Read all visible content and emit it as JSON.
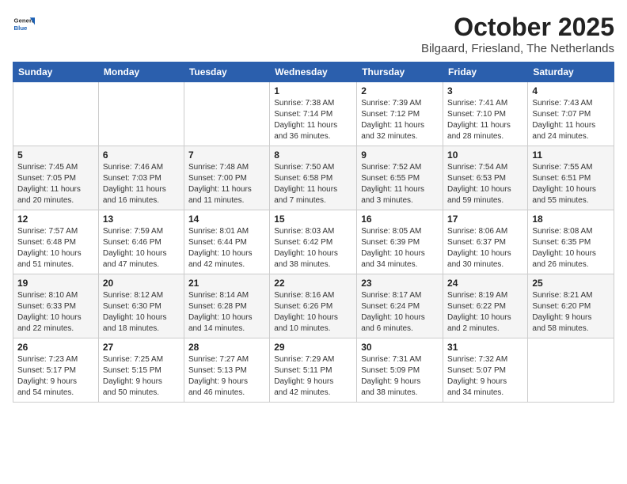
{
  "header": {
    "logo_general": "General",
    "logo_blue": "Blue",
    "month_title": "October 2025",
    "location": "Bilgaard, Friesland, The Netherlands"
  },
  "weekdays": [
    "Sunday",
    "Monday",
    "Tuesday",
    "Wednesday",
    "Thursday",
    "Friday",
    "Saturday"
  ],
  "weeks": [
    [
      {
        "day": "",
        "info": ""
      },
      {
        "day": "",
        "info": ""
      },
      {
        "day": "",
        "info": ""
      },
      {
        "day": "1",
        "info": "Sunrise: 7:38 AM\nSunset: 7:14 PM\nDaylight: 11 hours\nand 36 minutes."
      },
      {
        "day": "2",
        "info": "Sunrise: 7:39 AM\nSunset: 7:12 PM\nDaylight: 11 hours\nand 32 minutes."
      },
      {
        "day": "3",
        "info": "Sunrise: 7:41 AM\nSunset: 7:10 PM\nDaylight: 11 hours\nand 28 minutes."
      },
      {
        "day": "4",
        "info": "Sunrise: 7:43 AM\nSunset: 7:07 PM\nDaylight: 11 hours\nand 24 minutes."
      }
    ],
    [
      {
        "day": "5",
        "info": "Sunrise: 7:45 AM\nSunset: 7:05 PM\nDaylight: 11 hours\nand 20 minutes."
      },
      {
        "day": "6",
        "info": "Sunrise: 7:46 AM\nSunset: 7:03 PM\nDaylight: 11 hours\nand 16 minutes."
      },
      {
        "day": "7",
        "info": "Sunrise: 7:48 AM\nSunset: 7:00 PM\nDaylight: 11 hours\nand 11 minutes."
      },
      {
        "day": "8",
        "info": "Sunrise: 7:50 AM\nSunset: 6:58 PM\nDaylight: 11 hours\nand 7 minutes."
      },
      {
        "day": "9",
        "info": "Sunrise: 7:52 AM\nSunset: 6:55 PM\nDaylight: 11 hours\nand 3 minutes."
      },
      {
        "day": "10",
        "info": "Sunrise: 7:54 AM\nSunset: 6:53 PM\nDaylight: 10 hours\nand 59 minutes."
      },
      {
        "day": "11",
        "info": "Sunrise: 7:55 AM\nSunset: 6:51 PM\nDaylight: 10 hours\nand 55 minutes."
      }
    ],
    [
      {
        "day": "12",
        "info": "Sunrise: 7:57 AM\nSunset: 6:48 PM\nDaylight: 10 hours\nand 51 minutes."
      },
      {
        "day": "13",
        "info": "Sunrise: 7:59 AM\nSunset: 6:46 PM\nDaylight: 10 hours\nand 47 minutes."
      },
      {
        "day": "14",
        "info": "Sunrise: 8:01 AM\nSunset: 6:44 PM\nDaylight: 10 hours\nand 42 minutes."
      },
      {
        "day": "15",
        "info": "Sunrise: 8:03 AM\nSunset: 6:42 PM\nDaylight: 10 hours\nand 38 minutes."
      },
      {
        "day": "16",
        "info": "Sunrise: 8:05 AM\nSunset: 6:39 PM\nDaylight: 10 hours\nand 34 minutes."
      },
      {
        "day": "17",
        "info": "Sunrise: 8:06 AM\nSunset: 6:37 PM\nDaylight: 10 hours\nand 30 minutes."
      },
      {
        "day": "18",
        "info": "Sunrise: 8:08 AM\nSunset: 6:35 PM\nDaylight: 10 hours\nand 26 minutes."
      }
    ],
    [
      {
        "day": "19",
        "info": "Sunrise: 8:10 AM\nSunset: 6:33 PM\nDaylight: 10 hours\nand 22 minutes."
      },
      {
        "day": "20",
        "info": "Sunrise: 8:12 AM\nSunset: 6:30 PM\nDaylight: 10 hours\nand 18 minutes."
      },
      {
        "day": "21",
        "info": "Sunrise: 8:14 AM\nSunset: 6:28 PM\nDaylight: 10 hours\nand 14 minutes."
      },
      {
        "day": "22",
        "info": "Sunrise: 8:16 AM\nSunset: 6:26 PM\nDaylight: 10 hours\nand 10 minutes."
      },
      {
        "day": "23",
        "info": "Sunrise: 8:17 AM\nSunset: 6:24 PM\nDaylight: 10 hours\nand 6 minutes."
      },
      {
        "day": "24",
        "info": "Sunrise: 8:19 AM\nSunset: 6:22 PM\nDaylight: 10 hours\nand 2 minutes."
      },
      {
        "day": "25",
        "info": "Sunrise: 8:21 AM\nSunset: 6:20 PM\nDaylight: 9 hours\nand 58 minutes."
      }
    ],
    [
      {
        "day": "26",
        "info": "Sunrise: 7:23 AM\nSunset: 5:17 PM\nDaylight: 9 hours\nand 54 minutes."
      },
      {
        "day": "27",
        "info": "Sunrise: 7:25 AM\nSunset: 5:15 PM\nDaylight: 9 hours\nand 50 minutes."
      },
      {
        "day": "28",
        "info": "Sunrise: 7:27 AM\nSunset: 5:13 PM\nDaylight: 9 hours\nand 46 minutes."
      },
      {
        "day": "29",
        "info": "Sunrise: 7:29 AM\nSunset: 5:11 PM\nDaylight: 9 hours\nand 42 minutes."
      },
      {
        "day": "30",
        "info": "Sunrise: 7:31 AM\nSunset: 5:09 PM\nDaylight: 9 hours\nand 38 minutes."
      },
      {
        "day": "31",
        "info": "Sunrise: 7:32 AM\nSunset: 5:07 PM\nDaylight: 9 hours\nand 34 minutes."
      },
      {
        "day": "",
        "info": ""
      }
    ]
  ]
}
